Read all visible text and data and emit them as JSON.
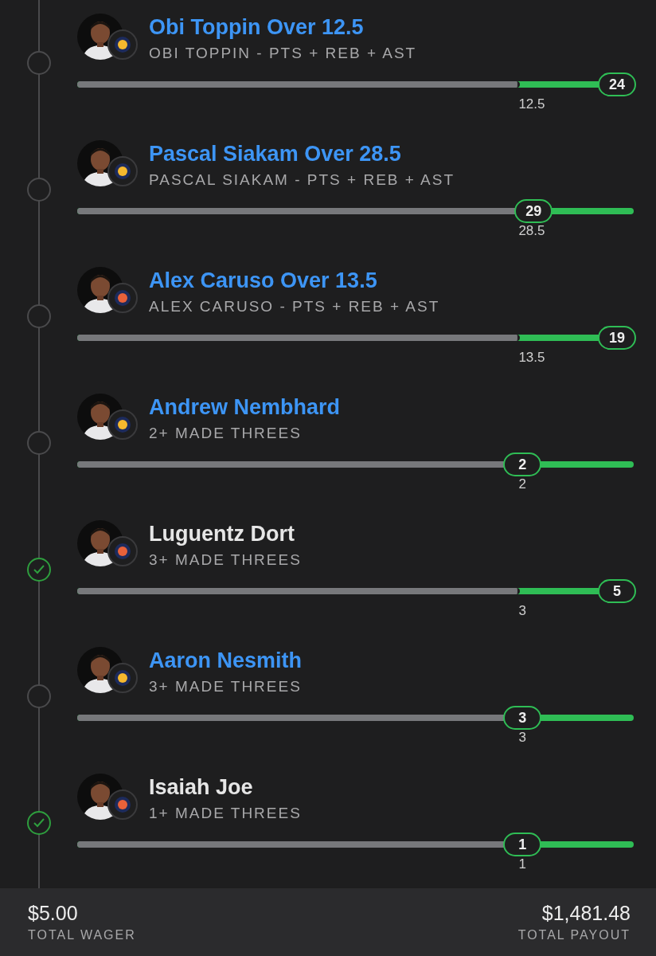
{
  "legs": [
    {
      "title": "Obi Toppin Over 12.5",
      "market": "OBI TOPPIN - PTS + REB + AST",
      "won": false,
      "badge": {
        "color": "#f5b82e"
      },
      "bar": {
        "level": 0.796,
        "line": "12.5"
      },
      "result": {
        "level": 0.97,
        "value": "24"
      }
    },
    {
      "title": "Pascal Siakam Over 28.5",
      "market": "PASCAL SIAKAM - PTS + REB + AST",
      "won": false,
      "badge": {
        "color": "#f5b82e"
      },
      "bar": {
        "level": 0.796,
        "line": "28.5"
      },
      "result": {
        "level": 0.82,
        "value": "29"
      }
    },
    {
      "title": "Alex Caruso Over 13.5",
      "market": "ALEX CARUSO - PTS + REB + AST",
      "won": false,
      "badge": {
        "color": "#e8613a"
      },
      "bar": {
        "level": 0.796,
        "line": "13.5"
      },
      "result": {
        "level": 0.97,
        "value": "19"
      }
    },
    {
      "title": "Andrew Nembhard",
      "market": "2+ MADE THREES",
      "won": false,
      "badge": {
        "color": "#f5b82e"
      },
      "bar": {
        "level": 0.796,
        "line": "2"
      },
      "result": {
        "level": 0.8,
        "value": "2"
      }
    },
    {
      "title": "Luguentz Dort",
      "market": "3+ MADE THREES",
      "won": true,
      "badge": {
        "color": "#e8613a"
      },
      "bar": {
        "level": 0.796,
        "line": "3"
      },
      "result": {
        "level": 0.97,
        "value": "5"
      }
    },
    {
      "title": "Aaron Nesmith",
      "market": "3+ MADE THREES",
      "won": false,
      "badge": {
        "color": "#f5b82e"
      },
      "bar": {
        "level": 0.796,
        "line": "3"
      },
      "result": {
        "level": 0.8,
        "value": "3"
      }
    },
    {
      "title": "Isaiah Joe",
      "market": "1+ MADE THREES",
      "won": true,
      "badge": {
        "color": "#e8613a"
      },
      "bar": {
        "level": 0.796,
        "line": "1"
      },
      "result": {
        "level": 0.8,
        "value": "1"
      }
    }
  ],
  "footer": {
    "wager": {
      "amount": "$5.00",
      "label": "TOTAL WAGER"
    },
    "payout": {
      "amount": "$1,481.48",
      "label": "TOTAL PAYOUT"
    }
  }
}
